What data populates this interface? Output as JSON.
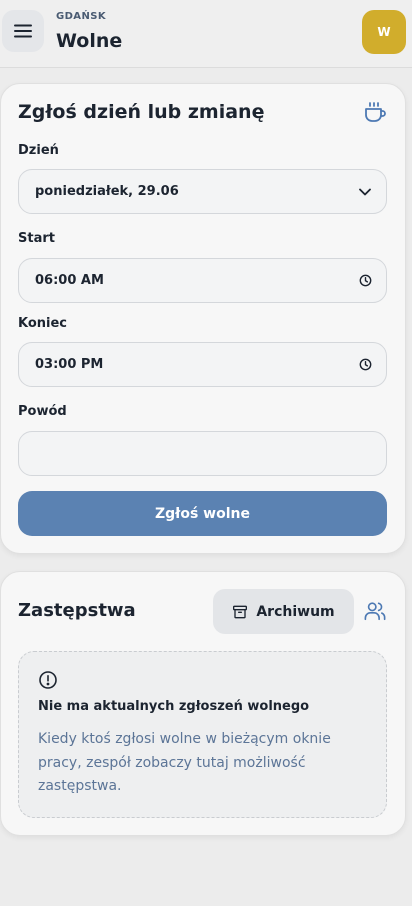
{
  "header": {
    "city": "GDAŃSK",
    "title": "Wolne",
    "avatar_initial": "W"
  },
  "request_form": {
    "title": "Zgłoś dzień lub zmianę",
    "day_label": "Dzień",
    "day_value": "poniedziałek, 29.06",
    "start_label": "Start",
    "start_value": "06:00 AM",
    "end_label": "Koniec",
    "end_value": "03:00 PM",
    "reason_label": "Powód",
    "reason_value": "",
    "submit_label": "Zgłoś wolne"
  },
  "substitutions": {
    "title": "Zastępstwa",
    "archive_label": "Archiwum",
    "empty_title": "Nie ma aktualnych zgłoszeń wolnego",
    "empty_text": "Kiedy ktoś zgłosi wolne w bieżącym oknie pracy, zespół zobaczy tutaj możliwość zastępstwa."
  },
  "colors": {
    "primary_button": "#5b82b2",
    "avatar_bg": "#d1ad2c",
    "muted_text": "#5c7597"
  },
  "icons": {
    "menu": "menu-icon",
    "coffee": "coffee-icon",
    "chevron": "chevron-down-icon",
    "clock": "clock-icon",
    "archive": "archive-icon",
    "users": "users-icon",
    "alert": "alert-circle-icon"
  }
}
